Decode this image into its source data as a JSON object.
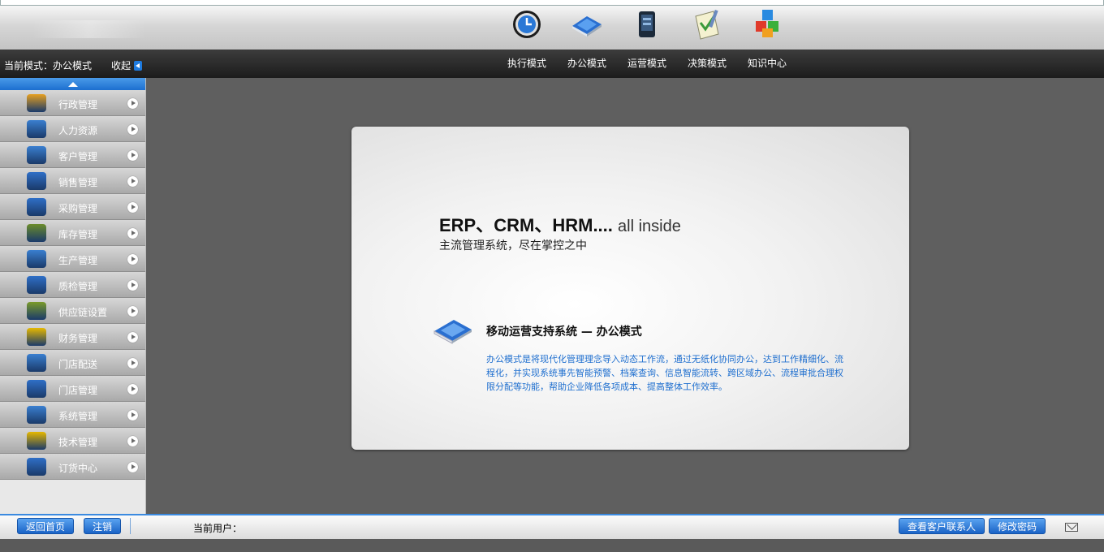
{
  "header": {
    "mode_status": "当前模式：办公模式",
    "collapse_label": "收起",
    "modes": [
      {
        "label": "执行模式",
        "icon": "clock-icon"
      },
      {
        "label": "办公模式",
        "icon": "book-icon"
      },
      {
        "label": "运营模式",
        "icon": "phone-icon"
      },
      {
        "label": "决策模式",
        "icon": "notepad-icon"
      },
      {
        "label": "知识中心",
        "icon": "cubes-icon"
      }
    ]
  },
  "sidebar": {
    "items": [
      {
        "label": "行政管理",
        "icon": "admin-icon",
        "color": "#e6a020"
      },
      {
        "label": "人力资源",
        "icon": "people-icon",
        "color": "#3a7fd0"
      },
      {
        "label": "客户管理",
        "icon": "customers-icon",
        "color": "#3a7fd0"
      },
      {
        "label": "销售管理",
        "icon": "clipboard-icon",
        "color": "#2f6fc7"
      },
      {
        "label": "采购管理",
        "icon": "document-icon",
        "color": "#2f6fc7"
      },
      {
        "label": "库存管理",
        "icon": "warehouse-icon",
        "color": "#6b8c2a"
      },
      {
        "label": "生产管理",
        "icon": "production-icon",
        "color": "#3a7fd0"
      },
      {
        "label": "质检管理",
        "icon": "inspection-icon",
        "color": "#2f6fc7"
      },
      {
        "label": "供应链设置",
        "icon": "supply-chain-icon",
        "color": "#7a9a2a"
      },
      {
        "label": "财务管理",
        "icon": "coins-icon",
        "color": "#e6b800"
      },
      {
        "label": "门店配送",
        "icon": "delivery-icon",
        "color": "#3a7fd0"
      },
      {
        "label": "门店管理",
        "icon": "store-icon",
        "color": "#2f6fc7"
      },
      {
        "label": "系统管理",
        "icon": "tools-icon",
        "color": "#3a7fd0"
      },
      {
        "label": "技术管理",
        "icon": "lightbulb-icon",
        "color": "#e6b800"
      },
      {
        "label": "订货中心",
        "icon": "order-icon",
        "color": "#2f6fc7"
      }
    ]
  },
  "main": {
    "headline_bold": "ERP、CRM、HRM....",
    "headline_light": "all inside",
    "subheadline": "主流管理系统，尽在掌控之中",
    "system_title": "移动运营支持系统 — 办公模式",
    "description": "办公模式是将现代化管理理念导入动态工作流，通过无纸化协同办公，达到工作精细化、流程化，并实现系统事先智能预警、档案查询、信息智能流转、跨区域办公、流程审批合理权限分配等功能，帮助企业降低各项成本、提高整体工作效率。"
  },
  "footer": {
    "home_button": "返回首页",
    "logout_button": "注销",
    "current_user_label": "当前用户：",
    "contacts_button": "查看客户联系人",
    "password_button": "修改密码"
  }
}
